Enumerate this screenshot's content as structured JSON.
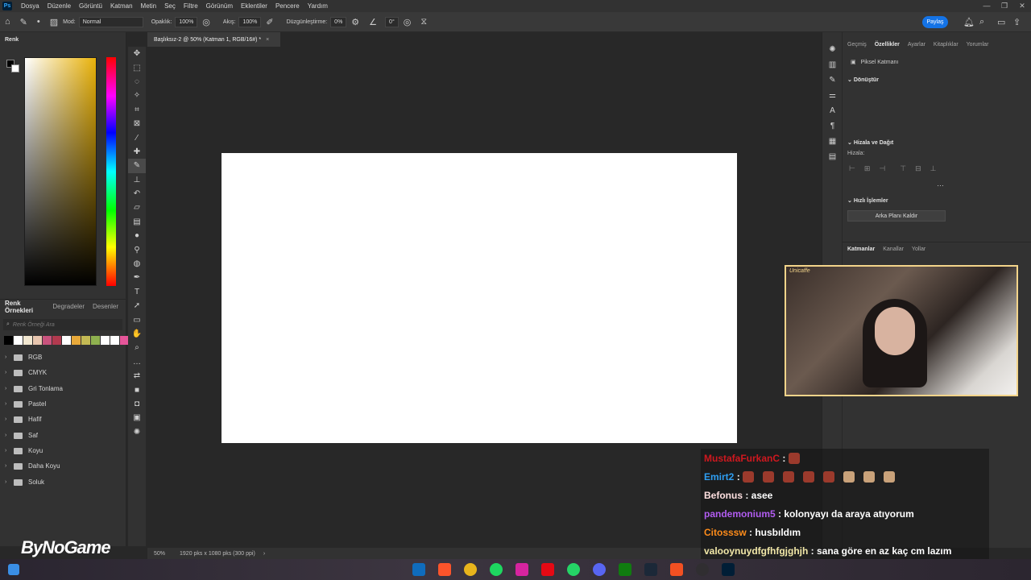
{
  "menubar": {
    "logo": "Ps",
    "items": [
      "Dosya",
      "Düzenle",
      "Görüntü",
      "Katman",
      "Metin",
      "Seç",
      "Filtre",
      "Görünüm",
      "Eklentiler",
      "Pencere",
      "Yardım"
    ]
  },
  "options": {
    "mode_label": "Mod:",
    "mode_value": "Normal",
    "opacity_label": "Opaklık:",
    "opacity_value": "100%",
    "flow_label": "Akış:",
    "flow_value": "100%",
    "smoothing_label": "Düzgünleştirme:",
    "smoothing_value": "0%",
    "angle_value": "0°",
    "share_label": "Paylaş"
  },
  "left_panel": {
    "color_title": "Renk",
    "swatch_tabs": [
      "Renk Örnekleri",
      "Degradeler",
      "Desenler"
    ],
    "search_placeholder": "Renk Örneği Ara",
    "swatches": [
      "#000000",
      "#ffffff",
      "#f1e7d0",
      "#e7c5ae",
      "#c9537d",
      "#b23a4f",
      "#ffffff",
      "#e8a93a",
      "#c4ba54",
      "#8fb14f",
      "#ffffff",
      "#ffffff",
      "#e6569a",
      "#f3a6c8"
    ],
    "folders": [
      "RGB",
      "CMYK",
      "Gri Tonlama",
      "Pastel",
      "Hafif",
      "Saf",
      "Koyu",
      "Daha Koyu",
      "Soluk"
    ]
  },
  "document": {
    "tab_title": "Başlıksız-2 @ 50% (Katman 1, RGB/16#) *",
    "zoom": "50%",
    "size_info": "1920 pks x 1080 pks (300 ppi)"
  },
  "properties": {
    "tabs": [
      "Geçmiş",
      "Özellikler",
      "Ayarlar",
      "Kitaplıklar",
      "Yorumlar"
    ],
    "layer_type": "Piksel Katmanı",
    "transform_title": "Dönüştür",
    "align_title": "Hizala ve Dağıt",
    "align_label": "Hizala:",
    "quick_title": "Hızlı İşlemler",
    "remove_bg": "Arka Planı Kaldır",
    "layer_tabs": [
      "Katmanlar",
      "Kanallar",
      "Yollar"
    ]
  },
  "webcam": {
    "label": "Unicaffe"
  },
  "chat": [
    {
      "user": "MustafaFurkanC",
      "color": "#d0181f",
      "text": " : ",
      "emotes": 1
    },
    {
      "user": "Emirt2",
      "color": "#2e9ef2",
      "text": " : ",
      "emotes": 8
    },
    {
      "user": "Befonus",
      "color": "#ffe0e0",
      "text": " : asee",
      "emotes": 0
    },
    {
      "user": "pandemonium5",
      "color": "#b15cf0",
      "text": " : kolonyayı da araya atıyorum",
      "emotes": 0
    },
    {
      "user": "Citosssw",
      "color": "#ff8c1a",
      "text": " : husbıldım",
      "emotes": 0
    },
    {
      "user": "valooynuydfgfhfgjghjh",
      "color": "#f2e8a8",
      "text": " : sana göre en az kaç cm lazım",
      "emotes": 0
    }
  ],
  "watermark": "ByNoGame",
  "colors": {
    "accent": "#1473e6",
    "panel": "#323232",
    "canvas": "#ffffff"
  }
}
